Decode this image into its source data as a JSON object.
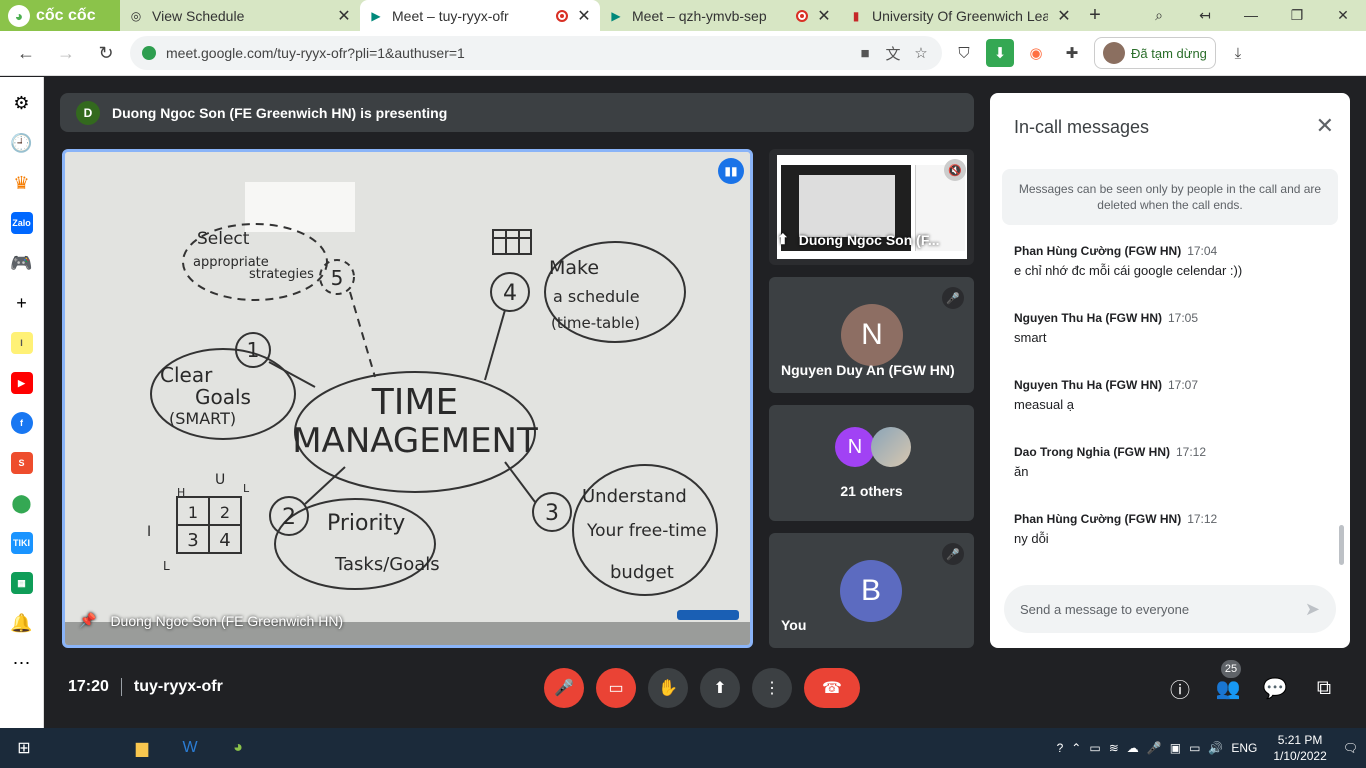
{
  "browser": {
    "brand": "cốc cốc",
    "tabs": [
      {
        "title": "View Schedule",
        "icon": "schedule-icon",
        "recording": false
      },
      {
        "title": "Meet – tuy-ryyx-ofr",
        "icon": "meet-icon",
        "recording": true
      },
      {
        "title": "Meet – qzh-ymvb-sep",
        "icon": "meet-icon",
        "recording": true
      },
      {
        "title": "University Of Greenwich Lear",
        "icon": "university-icon",
        "recording": false
      }
    ],
    "url": "meet.google.com/tuy-ryyx-ofr?pli=1&authuser=1",
    "profile_status": "Đã tạm dừng"
  },
  "meet": {
    "presenter_initial": "D",
    "presenter_banner": "Duong Ngoc Son (FE Greenwich HN) is presenting",
    "main_video_name": "Duong Ngoc Son (FE Greenwich HN)",
    "tiles": [
      {
        "name": "Duong Ngoc Son (F...",
        "type": "screen"
      },
      {
        "name": "Nguyen Duy An (FGW HN)",
        "initial": "N",
        "color": "#8d6e63"
      },
      {
        "name": "21 others",
        "initial": "N",
        "color": "#a142f4"
      },
      {
        "name": "You",
        "initial": "B",
        "color": "#5c6bc0"
      }
    ],
    "time": "17:20",
    "meeting_code": "tuy-ryyx-ofr",
    "participant_count": "25"
  },
  "whiteboard": {
    "center_top": "TIME",
    "center_bottom": "MANAGEMENT",
    "n1": "1",
    "b1a": "Clear",
    "b1b": "Goals",
    "b1c": "(SMART)",
    "n2": "2",
    "b2a": "Priority",
    "b2b": "Tasks/Goals",
    "n3": "3",
    "b3a": "Understand",
    "b3b": "Your free-time",
    "b3c": "budget",
    "n4": "4",
    "b4a": "Make",
    "b4b": "a schedule",
    "b4c": "(time-table)",
    "n5": "5",
    "b5a": "Select",
    "b5b": "appropriate",
    "b5c": "strategies",
    "grid": [
      "1",
      "2",
      "3",
      "4"
    ],
    "gu": "U",
    "gi": "I",
    "gh": "H",
    "gl": "L",
    "gl2": "L"
  },
  "chat": {
    "title": "In-call messages",
    "notice": "Messages can be seen only by people in the call and are deleted when the call ends.",
    "messages": [
      {
        "sender": "Phan Hùng Cường (FGW HN)",
        "time": "17:04",
        "text": "e chỉ nhớ đc mỗi cái google celendar :))"
      },
      {
        "sender": "Nguyen Thu Ha (FGW HN)",
        "time": "17:05",
        "text": "smart"
      },
      {
        "sender": "Nguyen Thu Ha (FGW HN)",
        "time": "17:07",
        "text": "measual ạ"
      },
      {
        "sender": "Dao Trong Nghia (FGW HN)",
        "time": "17:12",
        "text": "ăn"
      },
      {
        "sender": "Phan Hùng Cường (FGW HN)",
        "time": "17:12",
        "text": "ny dỗi"
      }
    ],
    "input_placeholder": "Send a message to everyone"
  },
  "taskbar": {
    "lang": "ENG",
    "time": "5:21 PM",
    "date": "1/10/2022"
  }
}
